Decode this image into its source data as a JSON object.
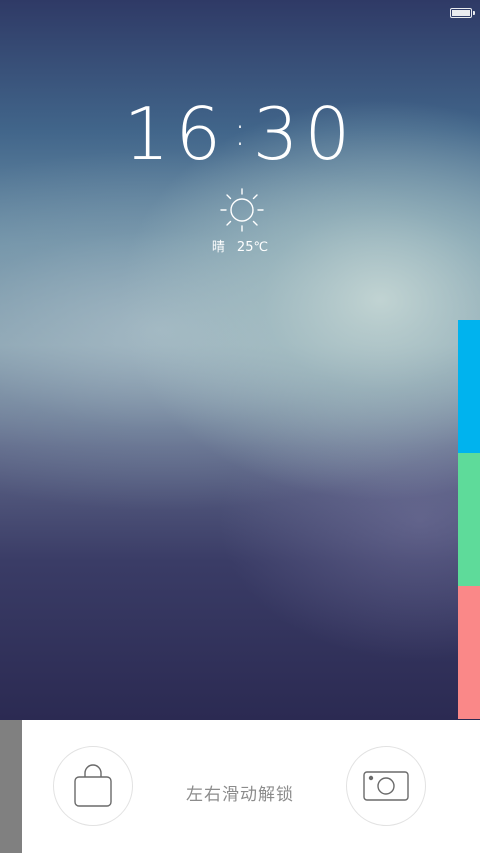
{
  "status_bar": {
    "battery_level": 1.0,
    "battery_icon": "battery-icon"
  },
  "lockscreen": {
    "time_hours": "16",
    "time_separator": ":",
    "time_minutes": "30",
    "weather": {
      "icon": "sun-icon",
      "condition": "晴",
      "temperature": "25℃"
    }
  },
  "side_tabs": [
    {
      "color": "#00b3ee"
    },
    {
      "color": "#5edb9a"
    },
    {
      "color": "#fa8888"
    }
  ],
  "bottom_bar": {
    "left_icon": "shopping-bag-icon",
    "right_icon": "camera-icon",
    "unlock_hint": "左右滑动解锁"
  }
}
